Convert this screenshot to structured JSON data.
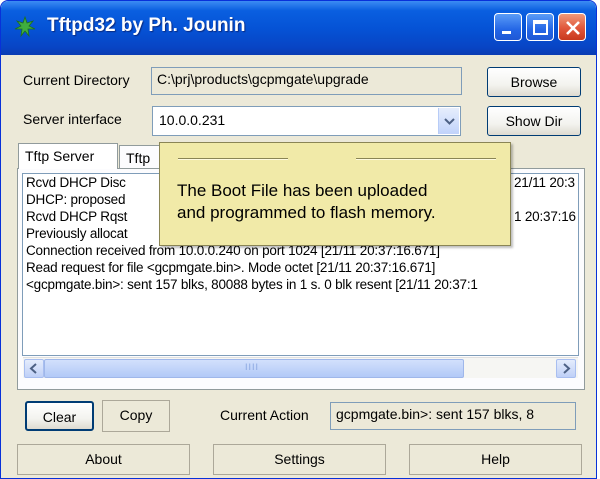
{
  "window": {
    "title": "Tftpd32 by Ph. Jounin"
  },
  "current_directory": {
    "label": "Current Directory",
    "value": "C:\\prj\\products\\gcpmgate\\upgrade",
    "browse_label": "Browse"
  },
  "server_interface": {
    "label": "Server interface",
    "value": "10.0.0.231",
    "show_dir_label": "Show Dir"
  },
  "tabs": [
    {
      "label": "Tftp Server"
    },
    {
      "label": "Tftp"
    }
  ],
  "log": {
    "lines": [
      "Rcvd DHCP Disc",
      "DHCP: proposed",
      "Rcvd DHCP Rqst",
      "Previously allocat",
      "Connection received from 10.0.0.240 on port 1024 [21/11 20:37:16.671]",
      "Read request for file <gcpmgate.bin>. Mode octet [21/11 20:37:16.671]",
      "<gcpmgate.bin>: sent 157 blks, 80088 bytes in 1 s. 0 blk resent [21/11 20:37:1"
    ],
    "right_fragments": [
      "21/11 20:3",
      "1 20:37:16"
    ]
  },
  "tooltip": {
    "line1": "The Boot File has been uploaded",
    "line2": "and programmed to flash memory."
  },
  "actions": {
    "clear_label": "Clear",
    "copy_label": "Copy",
    "current_action_label": "Current Action",
    "current_action_value": "gcpmgate.bin>: sent 157 blks, 8"
  },
  "bottom": {
    "about_label": "About",
    "settings_label": "Settings",
    "help_label": "Help"
  },
  "colors": {
    "titlebar": "#0553d6",
    "tooltip_bg": "#f1eaa8",
    "window_bg": "#ece9d8"
  },
  "scrollbar": {
    "thumb_grip": "IIII"
  }
}
